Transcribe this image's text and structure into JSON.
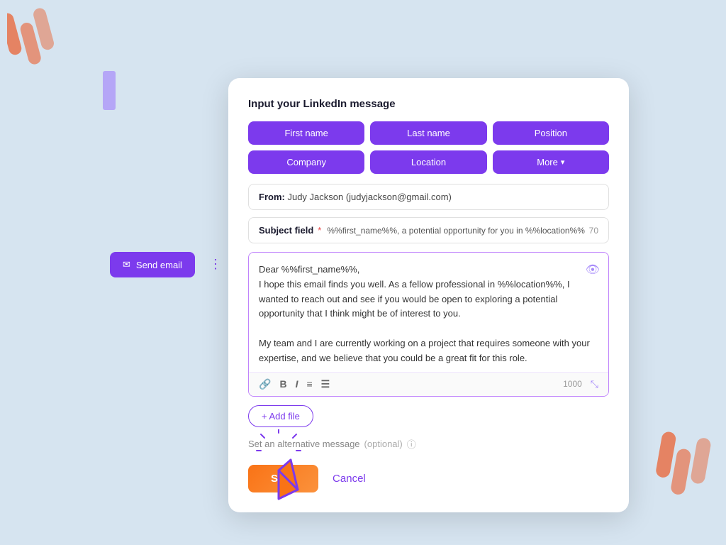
{
  "background": {
    "color": "#d6e4f0"
  },
  "decorative": {
    "wave_top_left_color": "#e8724a",
    "wave_bottom_right_color": "#e8724a",
    "purple_rect_color": "#a78bfa"
  },
  "send_email": {
    "label": "Send email",
    "icon": "✉"
  },
  "modal": {
    "title": "Input your LinkedIn message",
    "tags": [
      {
        "label": "First name",
        "has_chevron": false
      },
      {
        "label": "Last name",
        "has_chevron": false
      },
      {
        "label": "Position",
        "has_chevron": false
      },
      {
        "label": "Company",
        "has_chevron": false
      },
      {
        "label": "Location",
        "has_chevron": false
      },
      {
        "label": "More",
        "has_chevron": true
      }
    ],
    "from": {
      "label": "From:",
      "value": "Judy Jackson (judyjackson@gmail.com)"
    },
    "subject": {
      "label": "Subject field",
      "required": "*",
      "value": "%%first_name%%, a potential opportunity for you in %%location%%",
      "char_count": "70"
    },
    "message": {
      "content": "Dear %%first_name%%,\nI hope this email finds you well. As a fellow professional in %%location%%, I wanted to reach out and see if you would be open to exploring a potential opportunity that I think might be of interest to you.\n\nMy team and I are currently working on a project that requires someone with your expertise, and we believe that you could be a great fit for this role.",
      "char_count": "1000",
      "toolbar": {
        "link_icon": "🔗",
        "bold": "B",
        "italic": "I",
        "ordered_list": "≡",
        "unordered_list": "☰"
      }
    },
    "add_file_label": "+ Add file",
    "alt_message_label": "Set an alternative message",
    "alt_message_optional": "(optional)",
    "save_label": "Save",
    "cancel_label": "Cancel"
  }
}
